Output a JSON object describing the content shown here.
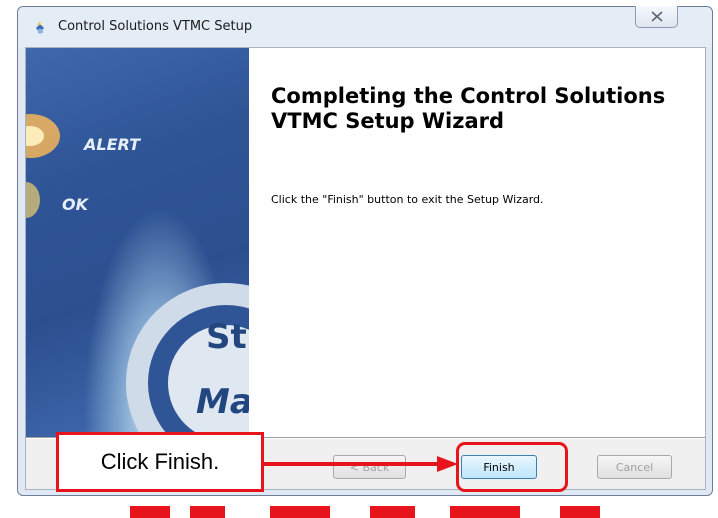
{
  "window": {
    "title": "Control Solutions VTMC Setup",
    "close_icon": "close-icon"
  },
  "banner": {
    "labels": [
      "ALERT",
      "OK",
      "St",
      "Ma"
    ]
  },
  "content": {
    "heading": "Completing the Control Solutions VTMC Setup Wizard",
    "message": "Click the \"Finish\" button to exit the Setup Wizard."
  },
  "buttons": {
    "back": "< Back",
    "finish": "Finish",
    "cancel": "Cancel"
  },
  "annotation": {
    "callout_text": "Click Finish.",
    "accent_color": "#e8141b"
  }
}
